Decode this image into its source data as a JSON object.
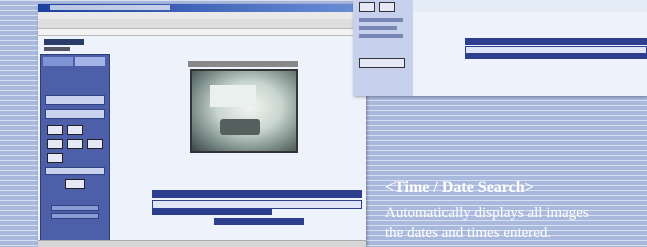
{
  "caption": {
    "title": "<Time / Date Search>",
    "lines": [
      "Automatically displays all images",
      "the dates and times entered."
    ]
  }
}
